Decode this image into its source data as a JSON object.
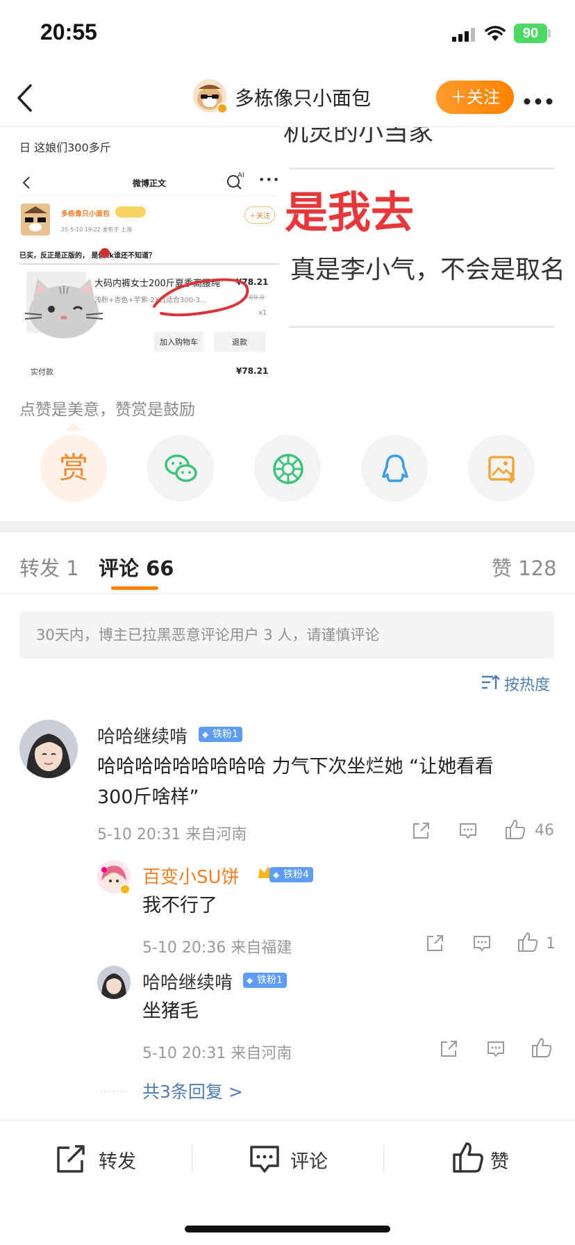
{
  "status_bar": {
    "time": "20:55",
    "battery": "90"
  },
  "nav": {
    "title": "多栋像只小面包",
    "follow_label": "＋关注"
  },
  "image": {
    "left_top_text": "日 这娘们300多斤",
    "screenshot": {
      "header_title": "微博正文",
      "ai_label": "AI",
      "user": "多栋像只小面包",
      "follow": "＋关注",
      "meta": "25-5-10  19:22  发布于 上海",
      "post": "已买，反正是正版的， 是假ck谁还不知道？",
      "product_title": "大码内裤女士200斤夏季高腰纯",
      "product_price": "¥78.21",
      "product_variant": "浅粉+杏色+芋紫-2XL[适合300-3...",
      "old_price": "¥89.9",
      "quantity": "x1",
      "add_cart": "加入购物车",
      "refund": "退款",
      "paid_label": "实付款",
      "paid_value": "¥78.21"
    },
    "right_text_top": "机灵的小当家",
    "right_red_text": "是我去",
    "right_text_mid": "真是李小气，不会是取名"
  },
  "reward_hint": "点赞是美意，赞赏是鼓励",
  "share": {
    "reward_label": "赏"
  },
  "tabs": {
    "forward": "转发 1",
    "comment": "评论 66",
    "like": "赞 128"
  },
  "notice": "30天内，博主已拉黑恶意评论用户 3 人，请谨慎评论",
  "sort_label": "按热度",
  "comments": [
    {
      "user": "哈哈继续啃",
      "badge": "铁粉1",
      "text_line1": "哈哈哈哈哈哈哈哈哈 力气下次坐烂她 “让她看看",
      "text_line2": "300斤啥样”",
      "meta": "5-10 20:31  来自河南",
      "likes": "46"
    }
  ],
  "replies": [
    {
      "user": "百变小SU饼",
      "badge": "铁粉4",
      "text": "我不行了",
      "meta": "5-10 20:36  来自福建",
      "likes": "1"
    },
    {
      "user": "哈哈继续啃",
      "badge": "铁粉1",
      "text": "坐猪毛",
      "meta": "5-10 20:31  来自河南",
      "likes": ""
    }
  ],
  "more_replies": "共3条回复 >",
  "bottom_bar": {
    "forward": "转发",
    "comment": "评论",
    "like": "赞"
  },
  "colors": {
    "accent": "#ff8200",
    "link": "#507daf",
    "badge": "#5f9cf5",
    "red": "#e6373b"
  }
}
